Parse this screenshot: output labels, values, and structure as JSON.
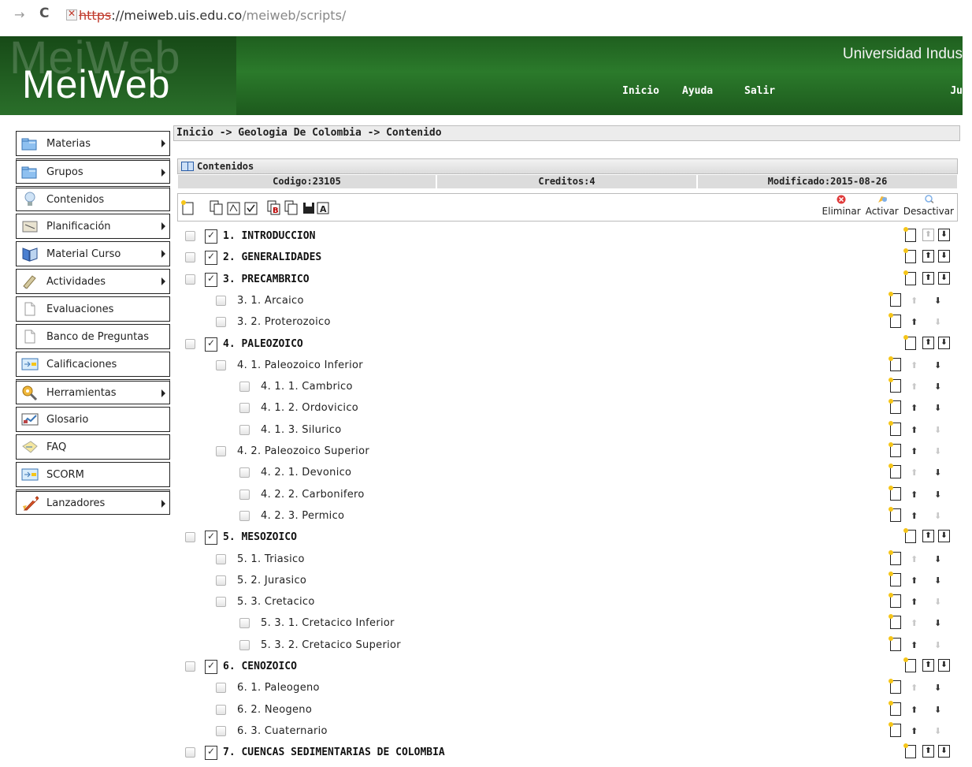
{
  "browser": {
    "forward_glyph": "→",
    "reload_glyph": "C",
    "url_scheme": "https",
    "url_host": "://meiweb.uis.edu.co",
    "url_path": "/meiweb/scripts/"
  },
  "header": {
    "logo": "MeiWeb",
    "university": "Universidad Indus",
    "menu": [
      "Inicio",
      "Ayuda",
      "Salir"
    ],
    "user_fragment": "Ju"
  },
  "sidebar": {
    "items": [
      {
        "label": "Materias",
        "icon": "folder-icon",
        "arrow": true
      },
      {
        "label": "Grupos",
        "icon": "folder-icon",
        "arrow": true
      },
      {
        "label": "Contenidos",
        "icon": "bulb-icon",
        "arrow": false
      },
      {
        "label": "Planificación",
        "icon": "notepad-icon",
        "arrow": true
      },
      {
        "label": "Material Curso",
        "icon": "book-icon",
        "arrow": true
      },
      {
        "label": "Actividades",
        "icon": "pencil-icon",
        "arrow": true
      },
      {
        "label": "Evaluaciones",
        "icon": "page-icon",
        "arrow": false
      },
      {
        "label": "Banco de Preguntas",
        "icon": "page-icon",
        "arrow": false
      },
      {
        "label": "Calificaciones",
        "icon": "grades-icon",
        "arrow": false
      },
      {
        "label": "Herramientas",
        "icon": "tools-icon",
        "arrow": true
      },
      {
        "label": "Glosario",
        "icon": "chart-icon",
        "arrow": false
      },
      {
        "label": "FAQ",
        "icon": "faq-icon",
        "arrow": false
      },
      {
        "label": "SCORM",
        "icon": "scorm-icon",
        "arrow": false
      },
      {
        "label": "Lanzadores",
        "icon": "rocket-icon",
        "arrow": true
      }
    ]
  },
  "breadcrumb": "Inicio -> Geologia De Colombia -> Contenido",
  "panel": {
    "title": "Contenidos",
    "codigo": "Codigo:23105",
    "creditos": "Creditos:4",
    "modificado": "Modificado:2015-08-26"
  },
  "toolbar": {
    "eliminar": "Eliminar",
    "activar": "Activar",
    "desactivar": "Desactivar"
  },
  "tree": [
    {
      "text": "1. INTRODUCCION",
      "level": 0,
      "up": false,
      "down": true
    },
    {
      "text": "2. GENERALIDADES",
      "level": 0,
      "up": true,
      "down": true
    },
    {
      "text": "3. PRECAMBRICO",
      "level": 0,
      "up": true,
      "down": true
    },
    {
      "text": "3. 1. Arcaico",
      "level": 1,
      "up": false,
      "down": true
    },
    {
      "text": "3. 2. Proterozoico",
      "level": 1,
      "up": true,
      "down": false
    },
    {
      "text": "4. PALEOZOICO",
      "level": 0,
      "up": true,
      "down": true
    },
    {
      "text": "4. 1. Paleozoico Inferior",
      "level": 1,
      "up": false,
      "down": true
    },
    {
      "text": "4. 1. 1. Cambrico",
      "level": 2,
      "up": false,
      "down": true
    },
    {
      "text": "4. 1. 2. Ordovicico",
      "level": 2,
      "up": true,
      "down": true
    },
    {
      "text": "4. 1. 3. Silurico",
      "level": 2,
      "up": true,
      "down": false
    },
    {
      "text": "4. 2. Paleozoico Superior",
      "level": 1,
      "up": true,
      "down": false
    },
    {
      "text": "4. 2. 1. Devonico",
      "level": 2,
      "up": false,
      "down": true
    },
    {
      "text": "4. 2. 2. Carbonifero",
      "level": 2,
      "up": true,
      "down": true
    },
    {
      "text": "4. 2. 3. Permico",
      "level": 2,
      "up": true,
      "down": false
    },
    {
      "text": "5. MESOZOICO",
      "level": 0,
      "up": true,
      "down": true
    },
    {
      "text": "5. 1. Triasico",
      "level": 1,
      "up": false,
      "down": true
    },
    {
      "text": "5. 2. Jurasico",
      "level": 1,
      "up": true,
      "down": true
    },
    {
      "text": "5. 3. Cretacico",
      "level": 1,
      "up": true,
      "down": false
    },
    {
      "text": "5. 3. 1. Cretacico Inferior",
      "level": 2,
      "up": false,
      "down": true
    },
    {
      "text": "5. 3. 2. Cretacico Superior",
      "level": 2,
      "up": true,
      "down": false
    },
    {
      "text": "6. CENOZOICO",
      "level": 0,
      "up": true,
      "down": true
    },
    {
      "text": "6. 1. Paleogeno",
      "level": 1,
      "up": false,
      "down": true
    },
    {
      "text": "6. 2. Neogeno",
      "level": 1,
      "up": true,
      "down": true
    },
    {
      "text": "6. 3. Cuaternario",
      "level": 1,
      "up": true,
      "down": false
    },
    {
      "text": "7. CUENCAS SEDIMENTARIAS DE COLOMBIA",
      "level": 0,
      "up": true,
      "down": true
    }
  ]
}
